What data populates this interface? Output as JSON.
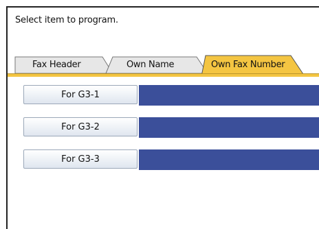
{
  "prompt": "Select item to program.",
  "tabs": [
    {
      "label": "Fax Header",
      "active": false
    },
    {
      "label": "Own Name",
      "active": false
    },
    {
      "label": "Own Fax Number",
      "active": true
    }
  ],
  "rows": [
    {
      "label": "For G3-1",
      "value": ""
    },
    {
      "label": "For G3-2",
      "value": ""
    },
    {
      "label": "For G3-3",
      "value": ""
    }
  ],
  "colors": {
    "active_tab": "#f4c542",
    "field_fill": "#3b4f9a",
    "button_top": "#ffffff",
    "button_bottom": "#dfe6ef"
  }
}
